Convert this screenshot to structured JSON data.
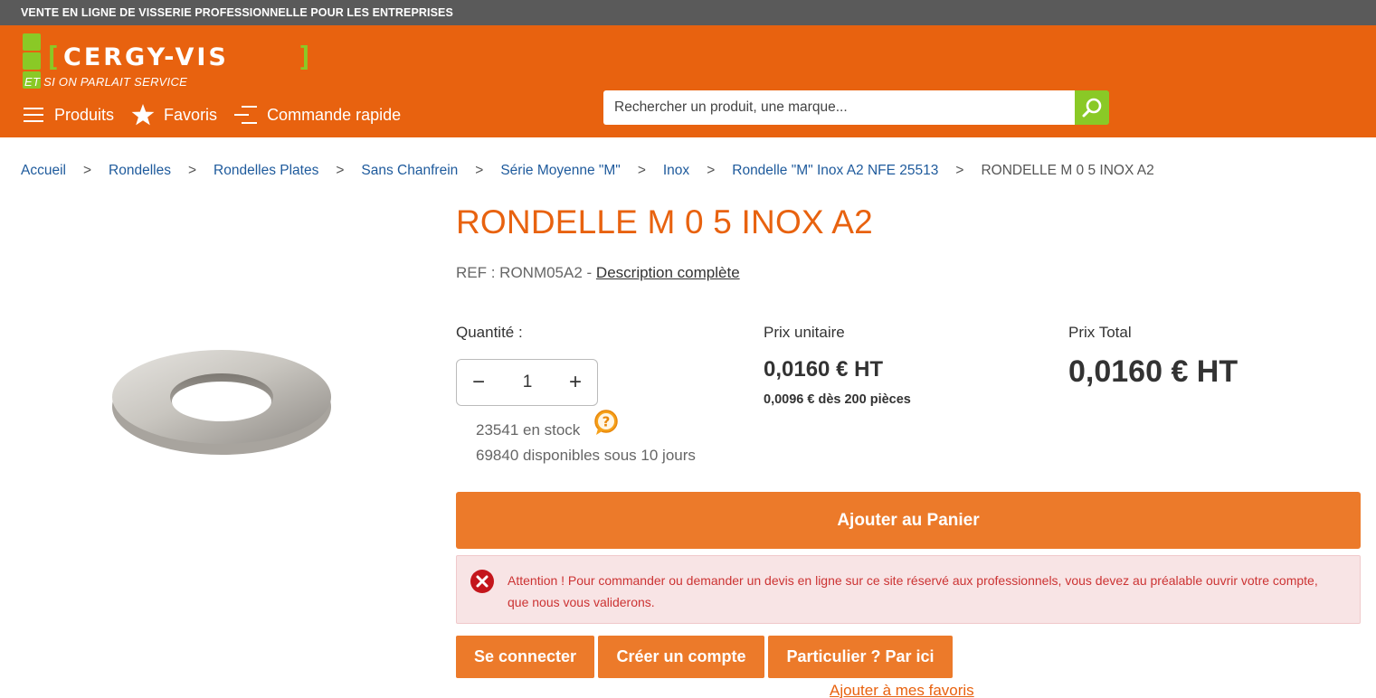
{
  "topbar": {
    "text": "VENTE EN LIGNE DE VISSERIE PROFESSIONNELLE POUR LES ENTREPRISES"
  },
  "header": {
    "logo": {
      "text": "CERGY-VIS",
      "bracket_left": "[",
      "bracket_right": "]",
      "tagline": "ET SI ON PARLAIT SERVICE"
    },
    "nav": {
      "products": "Produits",
      "favorites": "Favoris",
      "quick_order": "Commande rapide"
    },
    "search": {
      "placeholder": "Rechercher un produit, une marque..."
    }
  },
  "breadcrumb": {
    "separator": ">",
    "items": [
      "Accueil",
      "Rondelles",
      "Rondelles Plates",
      "Sans Chanfrein",
      "Série Moyenne \"M\"",
      "Inox",
      "Rondelle \"M\" Inox A2 NFE 25513",
      "RONDELLE M 0 5 INOX A2"
    ]
  },
  "product": {
    "title": "RONDELLE M 0 5 INOX A2",
    "ref_prefix": "REF : RONM05A2 - ",
    "description_link": "Description complète",
    "quantity_label": "Quantité :",
    "quantity_minus": "−",
    "quantity_value": "1",
    "quantity_plus": "+",
    "stock": "23541 en stock",
    "available": "69840 disponibles sous 10 jours",
    "unit_price_label": "Prix unitaire",
    "unit_price": "0,0160 € HT",
    "volume_price": "0,0096 € dès 200 pièces",
    "total_price_label": "Prix Total",
    "total_price": "0,0160 € HT",
    "add_to_cart": "Ajouter au Panier"
  },
  "alert": {
    "text": "Attention ! Pour commander ou demander un devis en ligne sur ce site réservé aux professionnels, vous devez au préalable ouvrir votre compte, que nous vous validerons."
  },
  "actions": {
    "login": "Se connecter",
    "create_account": "Créer un compte",
    "individual": "Particulier ? Par ici",
    "add_favorites": "Ajouter à mes favoris"
  },
  "colors": {
    "brand_orange": "#e8620f",
    "button_orange": "#ec7a2a",
    "brand_green": "#8ac926",
    "link_blue": "#1e5a9c",
    "alert_red": "#cc3333"
  }
}
